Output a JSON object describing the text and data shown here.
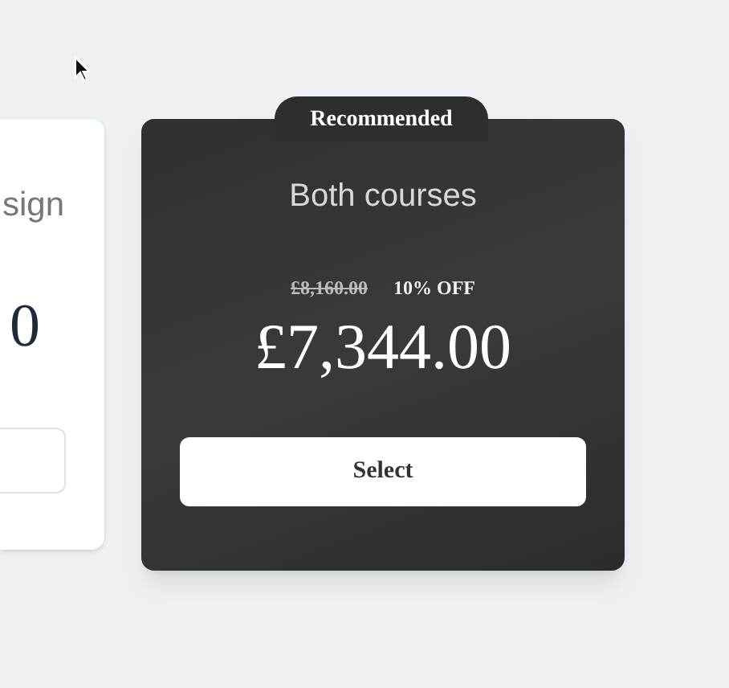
{
  "left_card": {
    "title": "sign",
    "price": "0"
  },
  "plan": {
    "badge": "Recommended",
    "title": "Both courses",
    "original_price": "£8,160.00",
    "discount": "10% OFF",
    "price": "£7,344.00",
    "button": "Select"
  }
}
